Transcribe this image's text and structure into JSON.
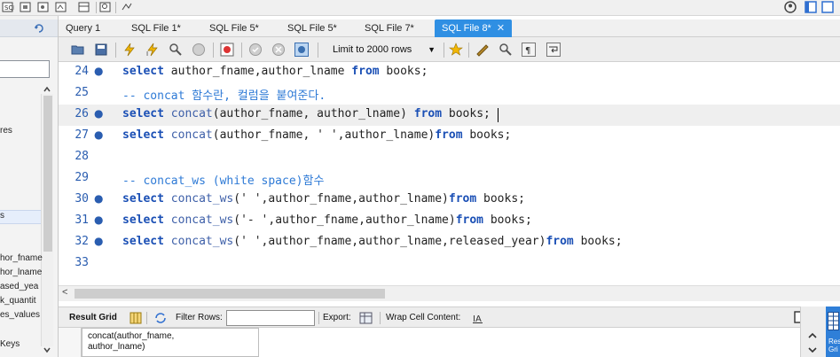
{
  "tabs": [
    {
      "label": "Query 1",
      "active": false
    },
    {
      "label": "SQL File 1*",
      "active": false
    },
    {
      "label": "SQL File 5*",
      "active": false
    },
    {
      "label": "SQL File 5*",
      "active": false
    },
    {
      "label": "SQL File 7*",
      "active": false
    },
    {
      "label": "SQL File 8*",
      "active": true
    }
  ],
  "toolbar": {
    "limit_label": "Limit to 2000 rows"
  },
  "navigator": {
    "items": [
      "res",
      "s",
      "hor_fname",
      "hor_lname",
      "ased_yea",
      "k_quantit",
      "es_values",
      "Keys"
    ]
  },
  "editor": {
    "lines": [
      {
        "num": "24",
        "dot": true,
        "code": "select author_fname,author_lname from books;",
        "comment": false
      },
      {
        "num": "25",
        "dot": false,
        "code": "-- concat 함수란, 컬럼을 붙여준다.",
        "comment": true
      },
      {
        "num": "26",
        "dot": true,
        "code": "select concat(author_fname, author_lname) from books;",
        "comment": false,
        "current": true
      },
      {
        "num": "27",
        "dot": true,
        "code": "select concat(author_fname, ' ',author_lname)from books;",
        "comment": false
      },
      {
        "num": "28",
        "dot": false,
        "code": "",
        "comment": false
      },
      {
        "num": "29",
        "dot": false,
        "code": "-- concat_ws (white space)함수",
        "comment": true
      },
      {
        "num": "30",
        "dot": true,
        "code": "select concat_ws(' ',author_fname,author_lname)from books;",
        "comment": false
      },
      {
        "num": "31",
        "dot": true,
        "code": "select concat_ws('- ',author_fname,author_lname)from books;",
        "comment": false
      },
      {
        "num": "32",
        "dot": true,
        "code": "select concat_ws(' ',author_fname,author_lname,released_year)from books;",
        "comment": false
      },
      {
        "num": "33",
        "dot": false,
        "code": "",
        "comment": false
      }
    ]
  },
  "result_bar": {
    "result_grid": "Result Grid",
    "filter_rows": "Filter Rows:",
    "export": "Export:",
    "wrap": "Wrap Cell Content:"
  },
  "grid": {
    "header": "concat(author_fname,\nauthor_lname)"
  },
  "right_panel": {
    "label": "Res\nGri"
  },
  "colors": {
    "accent": "#2f8fe3",
    "keyword": "#1a4fb5",
    "comment": "#2e7ad6"
  }
}
